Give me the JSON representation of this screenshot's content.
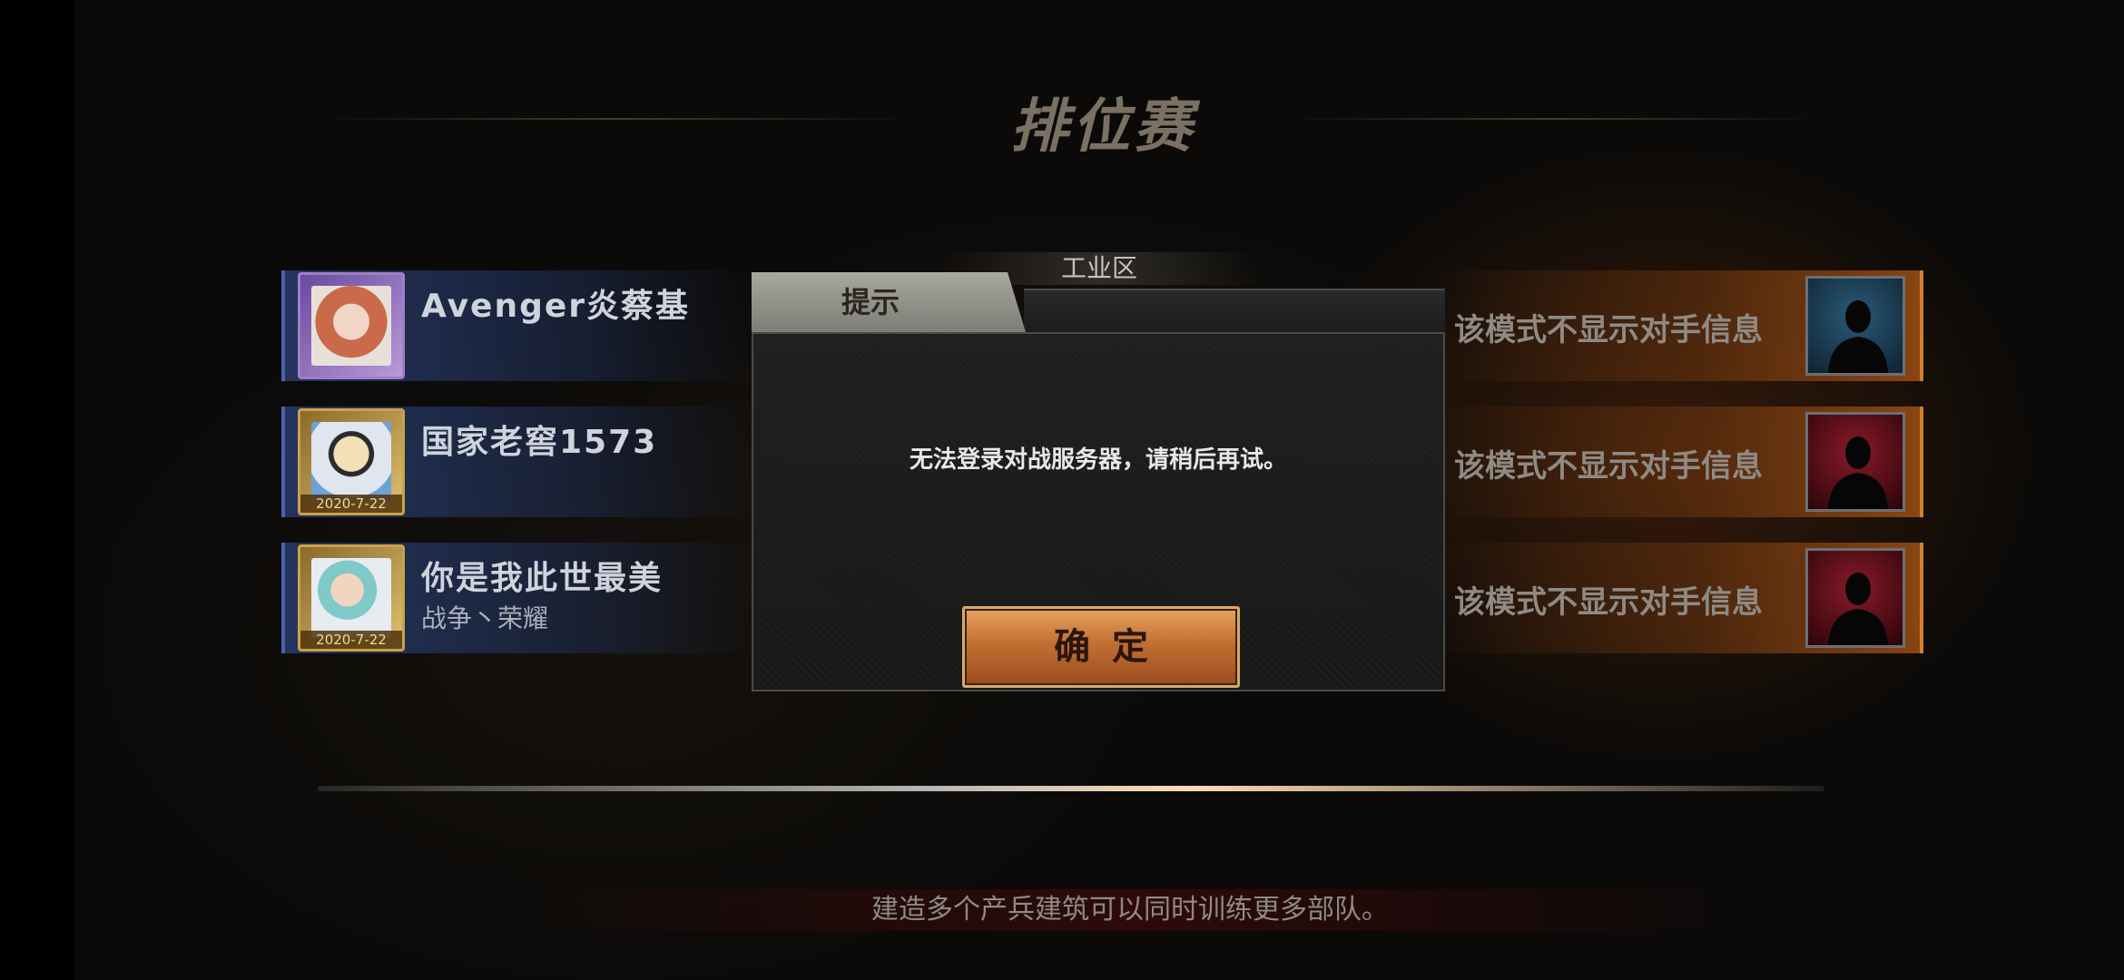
{
  "header": {
    "title": "排位赛",
    "map_name": "工业区"
  },
  "players": [
    {
      "name": "Avenger炎蔡基",
      "subtitle": "",
      "date": "",
      "frame": "purple"
    },
    {
      "name": "国家老窖1573",
      "subtitle": "",
      "date": "2020-7-22",
      "frame": "gold"
    },
    {
      "name": "你是我此世最美",
      "subtitle": "战争丶荣耀",
      "date": "2020-7-22",
      "frame": "gold"
    }
  ],
  "opponents": [
    {
      "text": "该模式不显示对手信息",
      "color": "blue"
    },
    {
      "text": "该模式不显示对手信息",
      "color": "red"
    },
    {
      "text": "该模式不显示对手信息",
      "color": "red"
    }
  ],
  "dialog": {
    "tab_label": "提示",
    "message": "无法登录对战服务器，请稍后再试。",
    "confirm_label": "确定"
  },
  "footer": {
    "tip": "建造多个产兵建筑可以同时训练更多部队。"
  }
}
